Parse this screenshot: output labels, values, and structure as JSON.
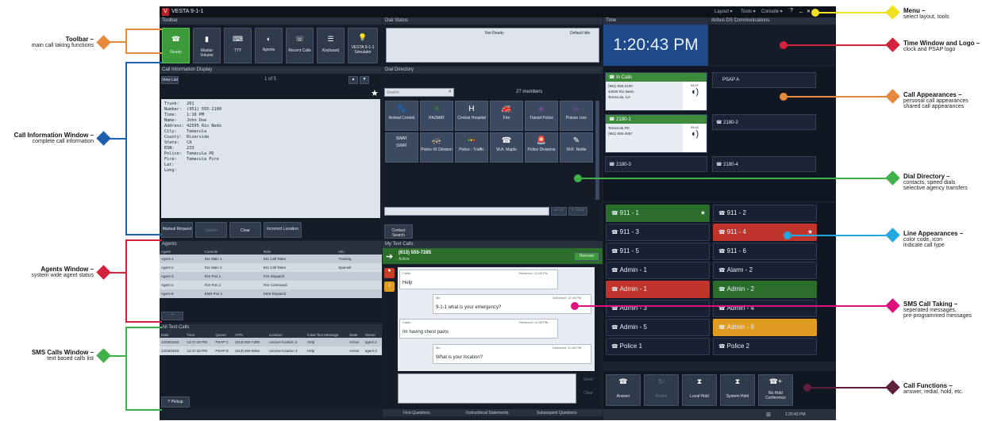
{
  "app": {
    "title": "VESTA 9-1-1",
    "menu": [
      "Layout ▾",
      "Tools ▾",
      "Console ▾"
    ],
    "help": "?",
    "min": "_",
    "close": "✕"
  },
  "toolbar": {
    "header": "Toolbar",
    "buttons": [
      {
        "label": "Ready",
        "icon": "phone-ready-icon"
      },
      {
        "label": "Master Volume",
        "icon": "volume-icon"
      },
      {
        "label": "TTY",
        "icon": "tty-icon"
      },
      {
        "label": "Agents",
        "icon": "agents-icon"
      },
      {
        "label": "Recent Calls",
        "icon": "recent-calls-icon"
      },
      {
        "label": "Keyboard",
        "icon": "keyboard-icon"
      },
      {
        "label": "VESTA 9-1-1 Simulator",
        "icon": "simulator-icon"
      }
    ]
  },
  "dial_status": {
    "header": "Dial Status",
    "status": "Not Ready",
    "default": "Default Idle"
  },
  "time": {
    "header": "Time",
    "value": "1:20:43 PM"
  },
  "airbus": {
    "header": "Airbus DS Communications"
  },
  "call_info": {
    "header": "Call Information Display",
    "view_list": "View List",
    "page": "1 of 5",
    "details": "Trunk:   201\nNumber:  (951) 555-2100\nTime:    1:16 PM\nName:    John Doe\nAddress: 42505 Rio Nedo\nCity:    Temecula\nCounty:  Riverside\nState:   CA\nESN:     233\nPolice:  Temecula PD\nFire:    Temecula Fire\nLat:\nLong:",
    "buttons": [
      "Manual Request",
      "Update",
      "Clear",
      "Incorrect Location"
    ]
  },
  "dial_directory": {
    "header": "Dial Directory",
    "search_placeholder": "Search",
    "members": "27 members",
    "tiles": [
      "Animal Control",
      "HAZMAT",
      "Central Hospital",
      "Fire",
      "Transit Police",
      "Poison Line",
      "SWAT",
      "Police 42 Division",
      "Police - Traffic",
      "W.A. Maple",
      "Police Divisions",
      "W.R. Nettle"
    ],
    "contact_search": "Contact Search"
  },
  "call_appearances": {
    "a1": {
      "title": "In Calls",
      "phone": "(951) 555-2100",
      "addr": "42505 Rio Nedo",
      "city": "Temecula, CA",
      "time": "06:07"
    },
    "a2": {
      "title": "PSAP A"
    },
    "a3": {
      "title": "2180-1",
      "name": "Temecula PD",
      "phone": "(951) 555-4557",
      "time": "09:42"
    },
    "a4": {
      "title": "2180-2"
    },
    "a5": {
      "title": "2180-3"
    },
    "a6": {
      "title": "2180-4"
    }
  },
  "lines": [
    "911 - 1",
    "911 - 2",
    "911 - 3",
    "911 - 4",
    "911 - 5",
    "911 - 6",
    "Admin - 1",
    "Alarm - 2",
    "Admin - 1",
    "Admin - 2",
    "Admin - 3",
    "Admin - 4",
    "Admin - 5",
    "Admin - 6",
    "Police 1",
    "Police 2"
  ],
  "agents": {
    "header": "Agents",
    "columns": [
      "Agent",
      "Console",
      "Role",
      "Info"
    ],
    "rows": [
      [
        "Agent 1",
        "911 Main 1",
        "911 Call Taker",
        "Training"
      ],
      [
        "Agent 2",
        "911 Main 2",
        "911 Call Taker",
        "Spanish"
      ],
      [
        "Agent 3",
        "Fire Pos 1",
        "Fire Dispatch",
        ""
      ],
      [
        "Agent 4",
        "Fire Pos 2",
        "Fire Command",
        ""
      ],
      [
        "Agent 5",
        "EMS Pos 1",
        "EMS Dispatch",
        ""
      ]
    ]
  },
  "all_text": {
    "header": "All Text Calls",
    "columns": [
      "Date",
      "Time",
      "Queue",
      "CPN",
      "Location",
      "Initial Text Message",
      "State",
      "Owner"
    ],
    "rows": [
      [
        "12/26/2016",
        "12:47:20 PM",
        "PSAP C",
        "(613) 555-7285",
        "concise location 2",
        "Help",
        "Active",
        "agent 2"
      ],
      [
        "12/26/2016",
        "12:47:20 PM",
        "PSAP D",
        "(613) 555-8066",
        "concise location 3",
        "Help",
        "Active",
        "agent 3"
      ]
    ],
    "pickup": "Pickup"
  },
  "my_text": {
    "header": "My Text Calls",
    "number": "(613) 555-7285",
    "state": "Active",
    "release": "Release",
    "messages": [
      {
        "from": "Caller",
        "meta": "Received: 12:45 PM",
        "text": "Help"
      },
      {
        "from": "Me",
        "meta": "Delivered: 12:45 PM",
        "text": "9-1-1 what is your emergency?"
      },
      {
        "from": "Caller",
        "meta": "Received: 12:45 PM",
        "text": "Im having chest pains"
      },
      {
        "from": "Me",
        "meta": "Delivered: 12:45 PM",
        "text": "What is your location?"
      }
    ],
    "send": "Send",
    "clear": "Clear",
    "tabs": [
      "First Questions",
      "Instructional Statements",
      "Subsequent Questions"
    ]
  },
  "call_functions": [
    "Answer",
    "Redial",
    "Local Hold",
    "System Hold",
    "No Hold Conference"
  ],
  "status_time": "1:20:43 PM",
  "annotations": {
    "toolbar": {
      "title": "Toolbar –",
      "desc": "main call taking functions"
    },
    "call_info": {
      "title": "Call Information Window –",
      "desc": "complete call information"
    },
    "agents": {
      "title": "Agents Window –",
      "desc": "system wide agent status"
    },
    "sms": {
      "title": "SMS Calls Window –",
      "desc": "text based calls list"
    },
    "menu": {
      "title": "Menu –",
      "desc": "select layout, tools"
    },
    "time": {
      "title": "Time Window and Logo –",
      "desc": "clock and PSAP logo"
    },
    "appearances": {
      "title": "Call Appearances –",
      "desc": "personal call appearances\nshared call appearances"
    },
    "directory": {
      "title": "Dial Directory –",
      "desc": "contacts, speed dials\nselective agency transfers"
    },
    "lines": {
      "title": "Line Appearances –",
      "desc": "color code, icon\nindicate call type"
    },
    "sms_taking": {
      "title": "SMS Call Taking –",
      "desc": "seperated messages,\npre-programmed messages"
    },
    "functions": {
      "title": "Call Functions –",
      "desc": "answer, redial, hold, etc."
    }
  },
  "colors": {
    "toolbar": "#e58a3c",
    "call_info": "#1e5fae",
    "agents": "#d4213d",
    "sms": "#3fb04a",
    "menu": "#f3e21e",
    "time": "#d4213d",
    "appearances": "#e58a3c",
    "directory": "#3fb04a",
    "lines": "#23a9e1",
    "sms_taking": "#e0117f",
    "functions": "#5e1f3d"
  }
}
